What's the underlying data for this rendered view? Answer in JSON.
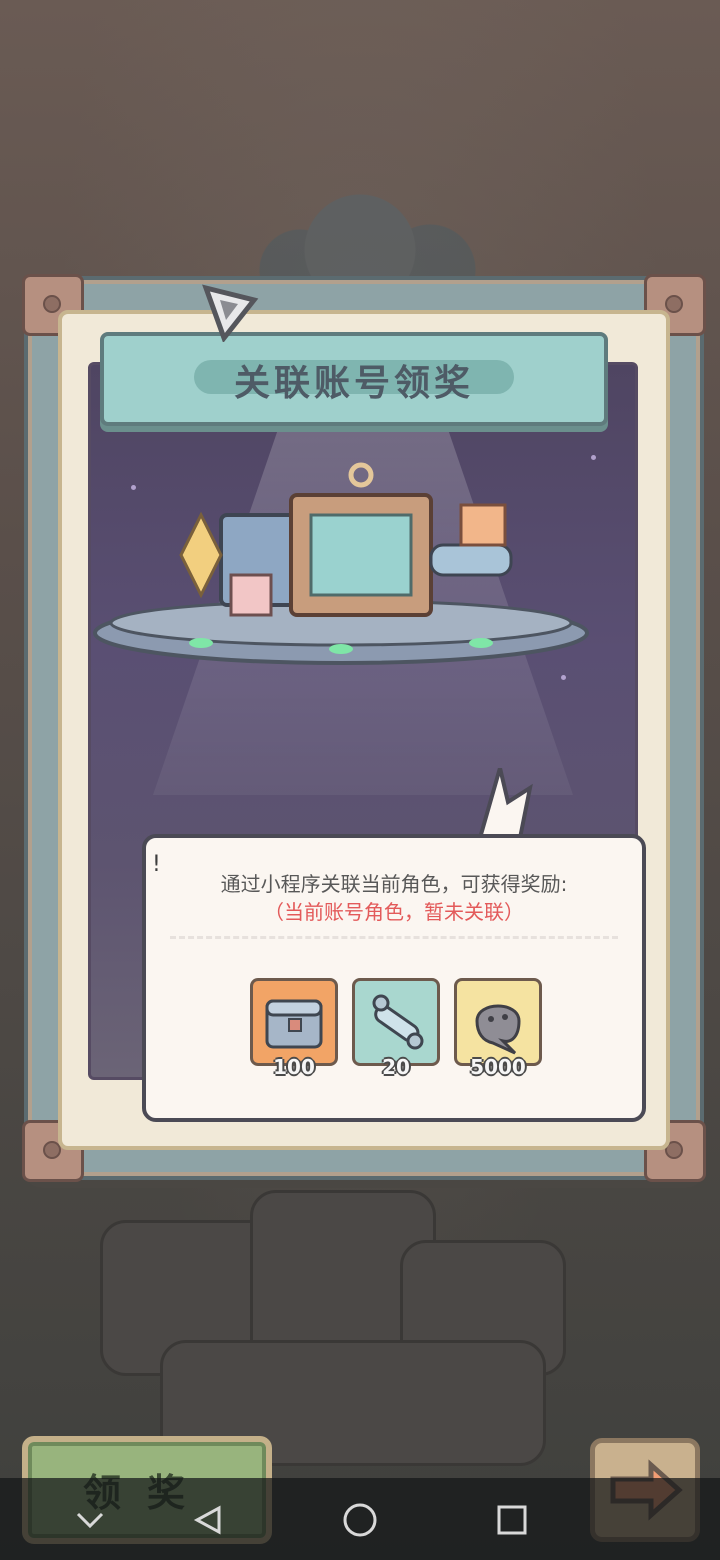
{
  "modal": {
    "title": "关联账号领奖",
    "description": "通过小程序关联当前角色，可获得奖励:",
    "status": "（当前账号角色，暂未关联）",
    "exclamation": "!"
  },
  "rewards": [
    {
      "icon": "treasure-chest-icon",
      "quantity": "100"
    },
    {
      "icon": "scroll-icon",
      "quantity": "20"
    },
    {
      "icon": "soul-blob-icon",
      "quantity": "5000"
    }
  ],
  "claim_button": {
    "label": "领奖"
  },
  "system_nav": {
    "items": [
      "chevron-down-icon",
      "back-triangle-icon",
      "home-circle-icon",
      "recents-square-icon"
    ]
  },
  "colors": {
    "title_plate": "#9fd0cc",
    "status_text": "#e35a5a",
    "claim_button": "#98b47d"
  }
}
